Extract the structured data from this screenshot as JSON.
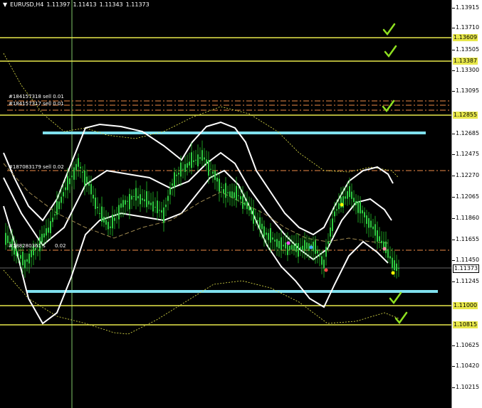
{
  "header": {
    "symbol": "EURUSD,H4",
    "open": "1.11397",
    "high": "1.11413",
    "low": "1.11343",
    "close": "1.11373"
  },
  "price_axis": {
    "ticks": [
      "1.13915",
      "1.13710",
      "1.13505",
      "1.13300",
      "1.13095",
      "1.12685",
      "1.12475",
      "1.12270",
      "1.12065",
      "1.11860",
      "1.11655",
      "1.11450",
      "1.11245",
      "1.10625",
      "1.10420",
      "1.10215"
    ],
    "current_price": "1.11373",
    "levels": [
      "1.13609",
      "1.13387",
      "1.12855",
      "1.11000",
      "1.10815"
    ]
  },
  "orders": [
    {
      "label": "#184157318 sell 0.01"
    },
    {
      "label": "#184157317 sell 0.01"
    },
    {
      "label": "#187083179 sell 0.02"
    },
    {
      "label": "#188280361 s"
    },
    {
      "label": "0.02"
    }
  ],
  "colors": {
    "background": "#000000",
    "level_line": "#e8e84a",
    "support_resistance": "#7fe0ee",
    "bands": "#ffffff",
    "candles": "#22c22a",
    "check": "#8fe020",
    "order_line": "#c0703a"
  },
  "icons": [
    "dropdown-arrow-icon",
    "checkmark-icon"
  ]
}
